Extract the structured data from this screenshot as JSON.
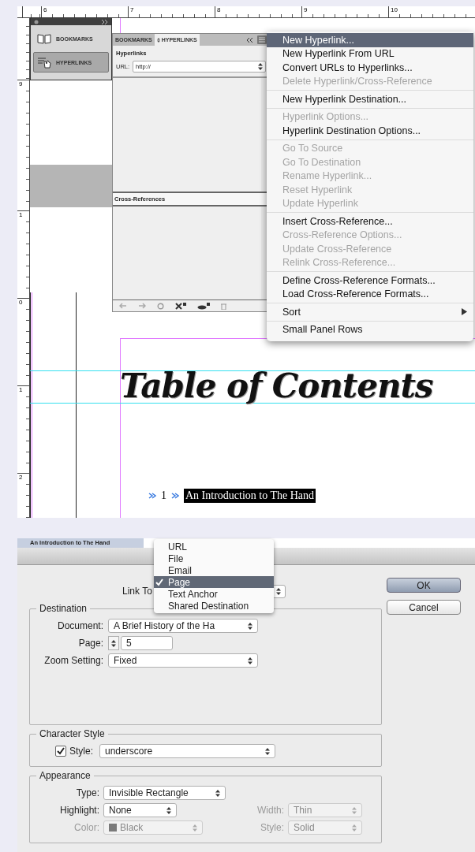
{
  "top_ruler": {
    "labels": [
      "6",
      "7",
      "8",
      "9",
      "10"
    ]
  },
  "side_ruler": {
    "labels": [
      "9",
      "1",
      "0",
      "1",
      "2"
    ]
  },
  "icon_panel": {
    "items": [
      {
        "label": "BOOKMARKS",
        "selected": false,
        "kind": "book"
      },
      {
        "label": "HYPERLINKS",
        "selected": true,
        "kind": "hyperlink"
      }
    ]
  },
  "hyperlinks_panel": {
    "tabs": [
      {
        "label": "BOOKMARKS",
        "selected": false
      },
      {
        "label": "HYPERLINKS",
        "selected": true
      }
    ],
    "heading": "Hyperlinks",
    "url_label": "URL:",
    "url_value": "http://",
    "cross_references_heading": "Cross-References"
  },
  "panel_menu": {
    "groups": [
      [
        {
          "label": "New Hyperlink...",
          "disabled": false,
          "selected": true,
          "submenu": false
        },
        {
          "label": "New Hyperlink From URL",
          "disabled": false,
          "selected": false,
          "submenu": false
        },
        {
          "label": "Convert URLs to Hyperlinks...",
          "disabled": false,
          "selected": false,
          "submenu": false
        },
        {
          "label": "Delete Hyperlink/Cross-Reference",
          "disabled": true,
          "selected": false,
          "submenu": false
        }
      ],
      [
        {
          "label": "New Hyperlink Destination...",
          "disabled": false,
          "selected": false,
          "submenu": false
        }
      ],
      [
        {
          "label": "Hyperlink Options...",
          "disabled": true,
          "selected": false,
          "submenu": false
        },
        {
          "label": "Hyperlink Destination Options...",
          "disabled": false,
          "selected": false,
          "submenu": false
        }
      ],
      [
        {
          "label": "Go To Source",
          "disabled": true,
          "selected": false,
          "submenu": false
        },
        {
          "label": "Go To Destination",
          "disabled": true,
          "selected": false,
          "submenu": false
        },
        {
          "label": "Rename Hyperlink...",
          "disabled": true,
          "selected": false,
          "submenu": false
        },
        {
          "label": "Reset Hyperlink",
          "disabled": true,
          "selected": false,
          "submenu": false
        },
        {
          "label": "Update Hyperlink",
          "disabled": true,
          "selected": false,
          "submenu": false
        }
      ],
      [
        {
          "label": "Insert Cross-Reference...",
          "disabled": false,
          "selected": false,
          "submenu": false
        },
        {
          "label": "Cross-Reference Options...",
          "disabled": true,
          "selected": false,
          "submenu": false
        },
        {
          "label": "Update Cross-Reference",
          "disabled": true,
          "selected": false,
          "submenu": false
        },
        {
          "label": "Relink Cross-Reference...",
          "disabled": true,
          "selected": false,
          "submenu": false
        }
      ],
      [
        {
          "label": "Define Cross-Reference Formats...",
          "disabled": false,
          "selected": false,
          "submenu": false
        },
        {
          "label": "Load Cross-Reference Formats...",
          "disabled": false,
          "selected": false,
          "submenu": false
        }
      ],
      [
        {
          "label": "Sort",
          "disabled": false,
          "selected": false,
          "submenu": true
        }
      ],
      [
        {
          "label": "Small Panel Rows",
          "disabled": false,
          "selected": false,
          "submenu": false
        }
      ]
    ]
  },
  "document": {
    "title": "Table of Contents",
    "toc_entries": [
      {
        "number": "1",
        "text": "An Introduction to The Hand",
        "selected": true
      }
    ]
  },
  "document_tab": {
    "label": "An Introduction to The Hand"
  },
  "dialog": {
    "link_to_label": "Link To",
    "link_to_options": [
      {
        "label": "URL",
        "selected": false
      },
      {
        "label": "File",
        "selected": false
      },
      {
        "label": "Email",
        "selected": false
      },
      {
        "label": "Page",
        "selected": true
      },
      {
        "label": "Text Anchor",
        "selected": false
      },
      {
        "label": "Shared Destination",
        "selected": false
      }
    ],
    "buttons": [
      {
        "label": "OK",
        "default": true
      },
      {
        "label": "Cancel",
        "default": false
      }
    ],
    "destination": {
      "title": "Destination",
      "fields": [
        {
          "label": "Document:",
          "value": "A Brief History of the Ha",
          "kind": "select",
          "disabled": false
        },
        {
          "label": "Page:",
          "value": "5",
          "kind": "stepper",
          "disabled": false
        },
        {
          "label": "Zoom Setting:",
          "value": "Fixed",
          "kind": "select",
          "disabled": false
        }
      ]
    },
    "character_style": {
      "title": "Character Style",
      "checked": true,
      "label": "Style:",
      "value": "underscore"
    },
    "appearance": {
      "title": "Appearance",
      "rows": [
        [
          {
            "label": "Type:",
            "value": "Invisible Rectangle",
            "kind": "select",
            "disabled": false
          }
        ],
        [
          {
            "label": "Highlight:",
            "value": "None",
            "kind": "select",
            "disabled": false
          },
          {
            "label": "Width:",
            "value": "Thin",
            "kind": "select",
            "disabled": true
          }
        ],
        [
          {
            "label": "Color:",
            "value": "Black",
            "kind": "swatch-select",
            "disabled": true
          },
          {
            "label": "Style:",
            "value": "Solid",
            "kind": "select",
            "disabled": true
          }
        ]
      ]
    }
  }
}
